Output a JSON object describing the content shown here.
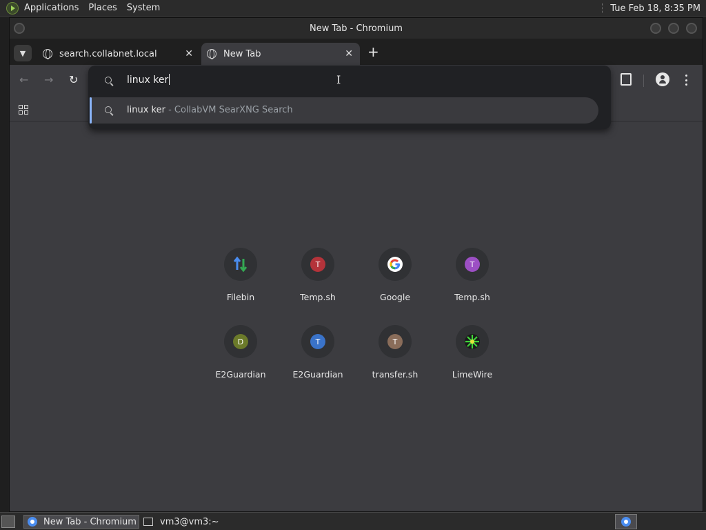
{
  "top_panel": {
    "menus": [
      "Applications",
      "Places",
      "System"
    ],
    "clock": "Tue Feb 18,  8:35 PM"
  },
  "window": {
    "title": "New Tab - Chromium"
  },
  "tabs": [
    {
      "label": "search.collabnet.local",
      "close": "✕"
    },
    {
      "label": "New Tab",
      "close": "✕"
    }
  ],
  "omnibox": {
    "input_value": "linux ker",
    "suggestion_query": "linux ker",
    "suggestion_source": " - CollabVM SearXNG Search"
  },
  "shortcuts": [
    {
      "label": "Filebin",
      "letter": "",
      "color": "#303134"
    },
    {
      "label": "Temp.sh",
      "letter": "T",
      "color": "#b4333a"
    },
    {
      "label": "Google",
      "letter": "",
      "color": "#ffffff"
    },
    {
      "label": "Temp.sh",
      "letter": "T",
      "color": "#9c4fc4"
    },
    {
      "label": "E2Guardian",
      "letter": "D",
      "color": "#6b7a2a"
    },
    {
      "label": "E2Guardian",
      "letter": "T",
      "color": "#3a73c9"
    },
    {
      "label": "transfer.sh",
      "letter": "T",
      "color": "#8a6d5a"
    },
    {
      "label": "LimeWire",
      "letter": "",
      "color": "#1a1a1a"
    }
  ],
  "taskbar": {
    "items": [
      "New Tab - Chromium",
      "vm3@vm3:~"
    ]
  }
}
